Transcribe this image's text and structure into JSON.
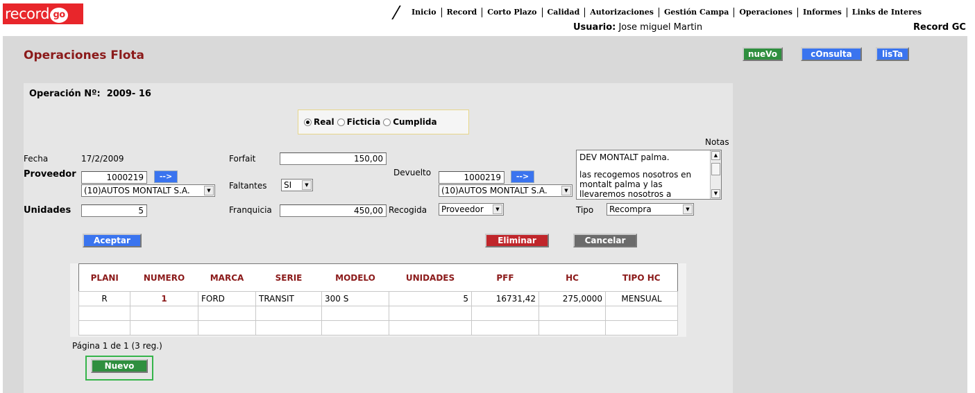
{
  "header": {
    "logo_text": "record",
    "logo_go": "go",
    "menu": [
      "Inicio",
      "Record",
      "Corto Plazo",
      "Calidad",
      "Autorizaciones",
      "Gestión Campa",
      "Operaciones",
      "Informes",
      "Links de Interes"
    ],
    "user_label": "Usuario:",
    "user_name": "Jose miguel Martin",
    "company": "Record GC"
  },
  "page": {
    "title": "Operaciones Flota",
    "actions": {
      "nuevo": "nueVo",
      "consulta": "cOnsulta",
      "lista": "lisTa"
    }
  },
  "form": {
    "operacion_label": "Operación Nº:",
    "operacion_value": "2009- 16",
    "tipo_operacion": {
      "options": [
        "Real",
        "Ficticia",
        "Cumplida"
      ],
      "selected": "Real"
    },
    "fecha_label": "Fecha",
    "fecha_value": "17/2/2009",
    "proveedor_label": "Proveedor",
    "proveedor_code": "1000219",
    "proveedor_name": "(10)AUTOS MONTALT S.A.",
    "unidades_label": "Unidades",
    "unidades_value": "5",
    "forfait_label": "Forfait",
    "forfait_value": "150,00",
    "faltantes_label": "Faltantes",
    "faltantes_value": "SI",
    "franquicia_label": "Franquicia",
    "franquicia_value": "450,00",
    "devuelto_label": "Devuelto",
    "devuelto_code": "1000219",
    "devuelto_name": "(10)AUTOS MONTALT S.A.",
    "recogida_label": "Recogida",
    "recogida_value": "Proveedor",
    "notas_label": "Notas",
    "notas_line1": "DEV MONTALT palma.",
    "notas_line2": "las recogemos nosotros en montalt palma y las llevaremos nosotros a",
    "tipo_label": "Tipo",
    "tipo_value": "Recompra",
    "go_arrow": "-->",
    "aceptar": "Aceptar",
    "eliminar": "Eliminar",
    "cancelar": "Cancelar"
  },
  "table": {
    "headers": [
      "PLANI",
      "NUMERO",
      "MARCA",
      "SERIE",
      "MODELO",
      "UNIDADES",
      "PFF",
      "HC",
      "TIPO HC"
    ],
    "rows": [
      [
        "R",
        "1",
        "FORD",
        "TRANSIT",
        "300 S",
        "5",
        "16731,42",
        "275,0000",
        "MENSUAL"
      ],
      [
        "",
        "",
        "",
        "",
        "",
        "",
        "",
        "",
        ""
      ],
      [
        "",
        "",
        "",
        "",
        "",
        "",
        "",
        "",
        ""
      ]
    ],
    "pager": "Página 1 de 1 (3 reg.)",
    "nuevo": "Nuevo"
  }
}
